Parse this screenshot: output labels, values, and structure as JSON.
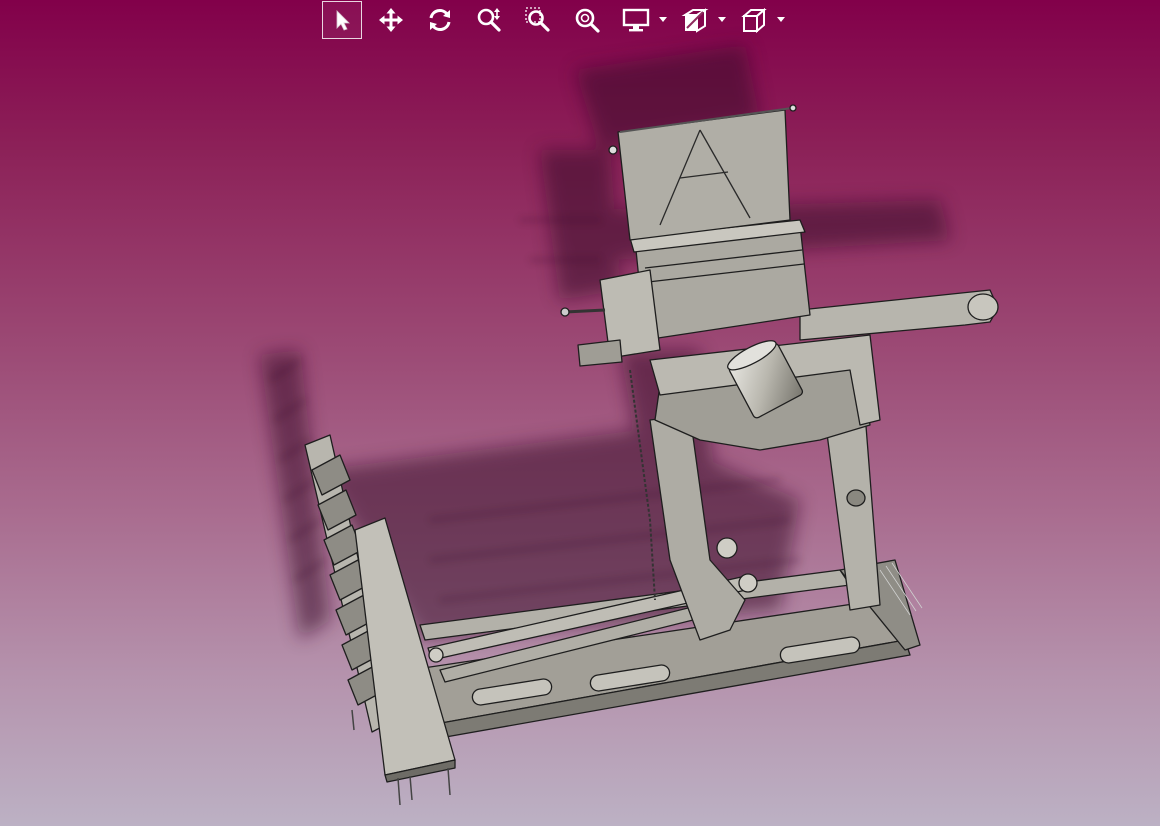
{
  "toolbar": {
    "tools": [
      {
        "name": "select",
        "icon": "cursor-arrow-icon",
        "active": true
      },
      {
        "name": "pan",
        "icon": "move-arrows-icon",
        "active": false
      },
      {
        "name": "rotate",
        "icon": "rotate-icon",
        "active": false
      },
      {
        "name": "zoom",
        "icon": "zoom-updown-icon",
        "active": false
      },
      {
        "name": "zoom-window",
        "icon": "zoom-window-icon",
        "active": false
      },
      {
        "name": "zoom-fit",
        "icon": "zoom-fit-icon",
        "active": false
      },
      {
        "name": "display-mode",
        "icon": "monitor-icon",
        "active": false,
        "has_dropdown": true
      },
      {
        "name": "section",
        "icon": "section-cube-icon",
        "active": false,
        "has_dropdown": true
      },
      {
        "name": "view-orientation",
        "icon": "view-cube-icon",
        "active": false,
        "has_dropdown": true
      }
    ]
  },
  "viewport": {
    "background_top_color": "#82004a",
    "background_bottom_color": "#bcb1c4",
    "model_color": "#a7a59d",
    "model_edge_color": "#202020"
  }
}
